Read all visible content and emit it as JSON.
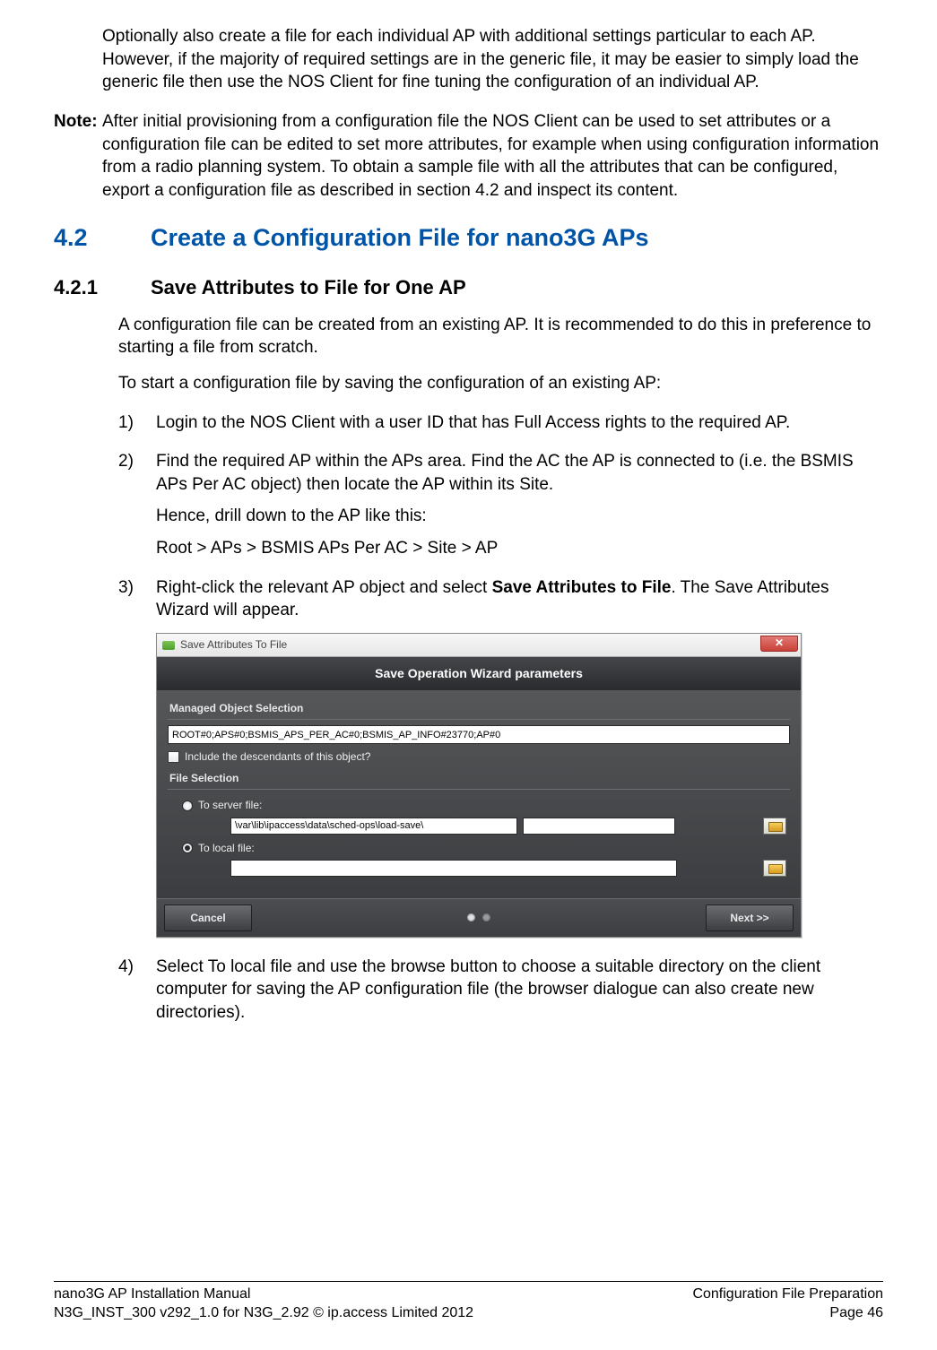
{
  "paras": {
    "intro1": "Optionally also create a file for each individual AP with additional settings particular to each AP. However, if the majority of required settings are in the generic file, it may be easier to simply load the generic file then use the NOS Client for fine tuning the configuration of an individual AP."
  },
  "note": {
    "label": "Note:",
    "text": "After initial provisioning from a configuration file the NOS Client can be used to set attributes or a configuration file can be edited to set more attributes, for example when using configuration information from a radio planning system. To obtain a sample file with all the attributes that can be configured, export a configuration file as described in section 4.2 and inspect its content."
  },
  "h2": {
    "num": "4.2",
    "text": "Create a Configuration File for nano3G APs"
  },
  "h3": {
    "num": "4.2.1",
    "text": "Save Attributes to File for One AP"
  },
  "body": {
    "p1": "A configuration file can be created from an existing AP. It is recommended to do this in preference to starting a file from scratch.",
    "p2": "To start a configuration file by saving the configuration of an existing AP:"
  },
  "steps": {
    "s1": {
      "n": "1)",
      "t": "Login to the NOS Client with a user ID that has Full Access rights to the required AP."
    },
    "s2": {
      "n": "2)",
      "t": "Find the required AP within the APs area. Find the AC the AP is connected to (i.e. the BSMIS APs Per AC object) then locate the AP within its Site.",
      "sub1": "Hence, drill down to the AP like this:",
      "sub2": "Root > APs > BSMIS APs Per AC > Site > AP"
    },
    "s3": {
      "n": "3)",
      "t_pre": "Right-click the relevant AP object and select ",
      "t_bold": "Save Attributes to File",
      "t_post": ". The Save Attributes Wizard will appear."
    },
    "s4": {
      "n": "4)",
      "t": "Select To local file and use the browse button to choose a suitable directory on the client computer for saving the AP configuration file (the browser dialogue can also create new directories)."
    }
  },
  "wizard": {
    "title": "Save Attributes To File",
    "band": "Save Operation Wizard parameters",
    "group1": "Managed Object Selection",
    "mo_value": "ROOT#0;APS#0;BSMIS_APS_PER_AC#0;BSMIS_AP_INFO#23770;AP#0",
    "include_label": "Include the descendants of this object?",
    "group2": "File Selection",
    "to_server": "To server file:",
    "server_path": "\\var\\lib\\ipaccess\\data\\sched-ops\\load-save\\",
    "to_local": "To local file:",
    "cancel": "Cancel",
    "next": "Next >>"
  },
  "footer": {
    "l1": "nano3G AP Installation Manual",
    "r1": "Configuration File Preparation",
    "l2": "N3G_INST_300 v292_1.0 for N3G_2.92 © ip.access Limited 2012",
    "r2": "Page 46"
  }
}
